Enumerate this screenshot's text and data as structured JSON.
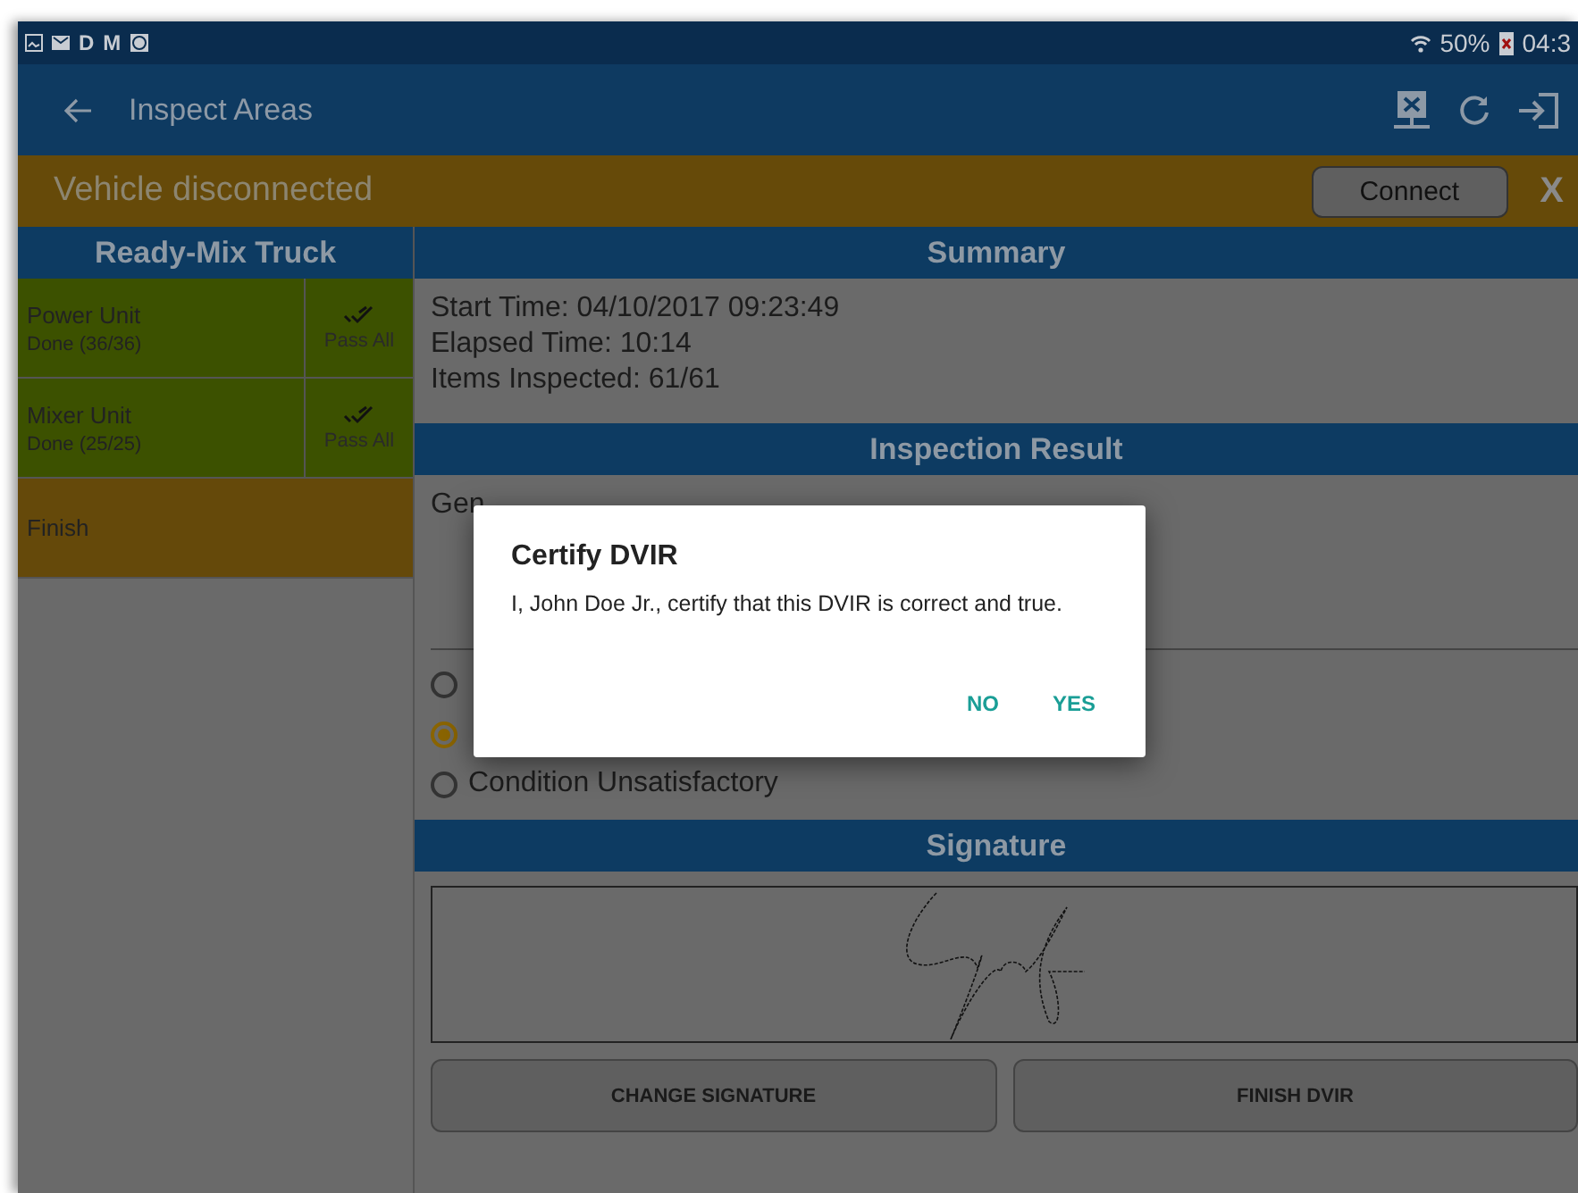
{
  "status_bar": {
    "left_texts": [
      "D",
      "M"
    ],
    "battery": "50%",
    "time": "04:3"
  },
  "app_bar": {
    "title": "Inspect Areas"
  },
  "banner": {
    "message": "Vehicle disconnected",
    "button": "Connect",
    "close": "X"
  },
  "sidebar": {
    "title": "Ready-Mix Truck",
    "items": [
      {
        "kind": "unit",
        "name": "Power Unit",
        "progress": "Done (36/36)",
        "done": true,
        "action": "Pass All"
      },
      {
        "kind": "unit",
        "name": "Mixer Unit",
        "progress": "Done (25/25)",
        "done": true,
        "action": "Pass All"
      },
      {
        "kind": "finish",
        "name": "Finish"
      }
    ]
  },
  "summary": {
    "title": "Summary",
    "lines": [
      "Start Time: 04/10/2017 09:23:49",
      "Elapsed Time: 10:14",
      "Items Inspected: 61/61"
    ]
  },
  "inspection_result": {
    "title": "Inspection Result",
    "comments_label": "Gen",
    "options": [
      {
        "selected": false
      },
      {
        "selected": true
      },
      {
        "label": "Condition Unsatisfactory",
        "selected": false
      }
    ]
  },
  "signature": {
    "title": "Signature",
    "buttons": [
      "CHANGE SIGNATURE",
      "FINISH DVIR"
    ]
  },
  "dialog": {
    "title": "Certify DVIR",
    "message": "I, John Doe Jr., certify that this DVIR is correct and true.",
    "buttons": [
      "NO",
      "YES"
    ]
  }
}
